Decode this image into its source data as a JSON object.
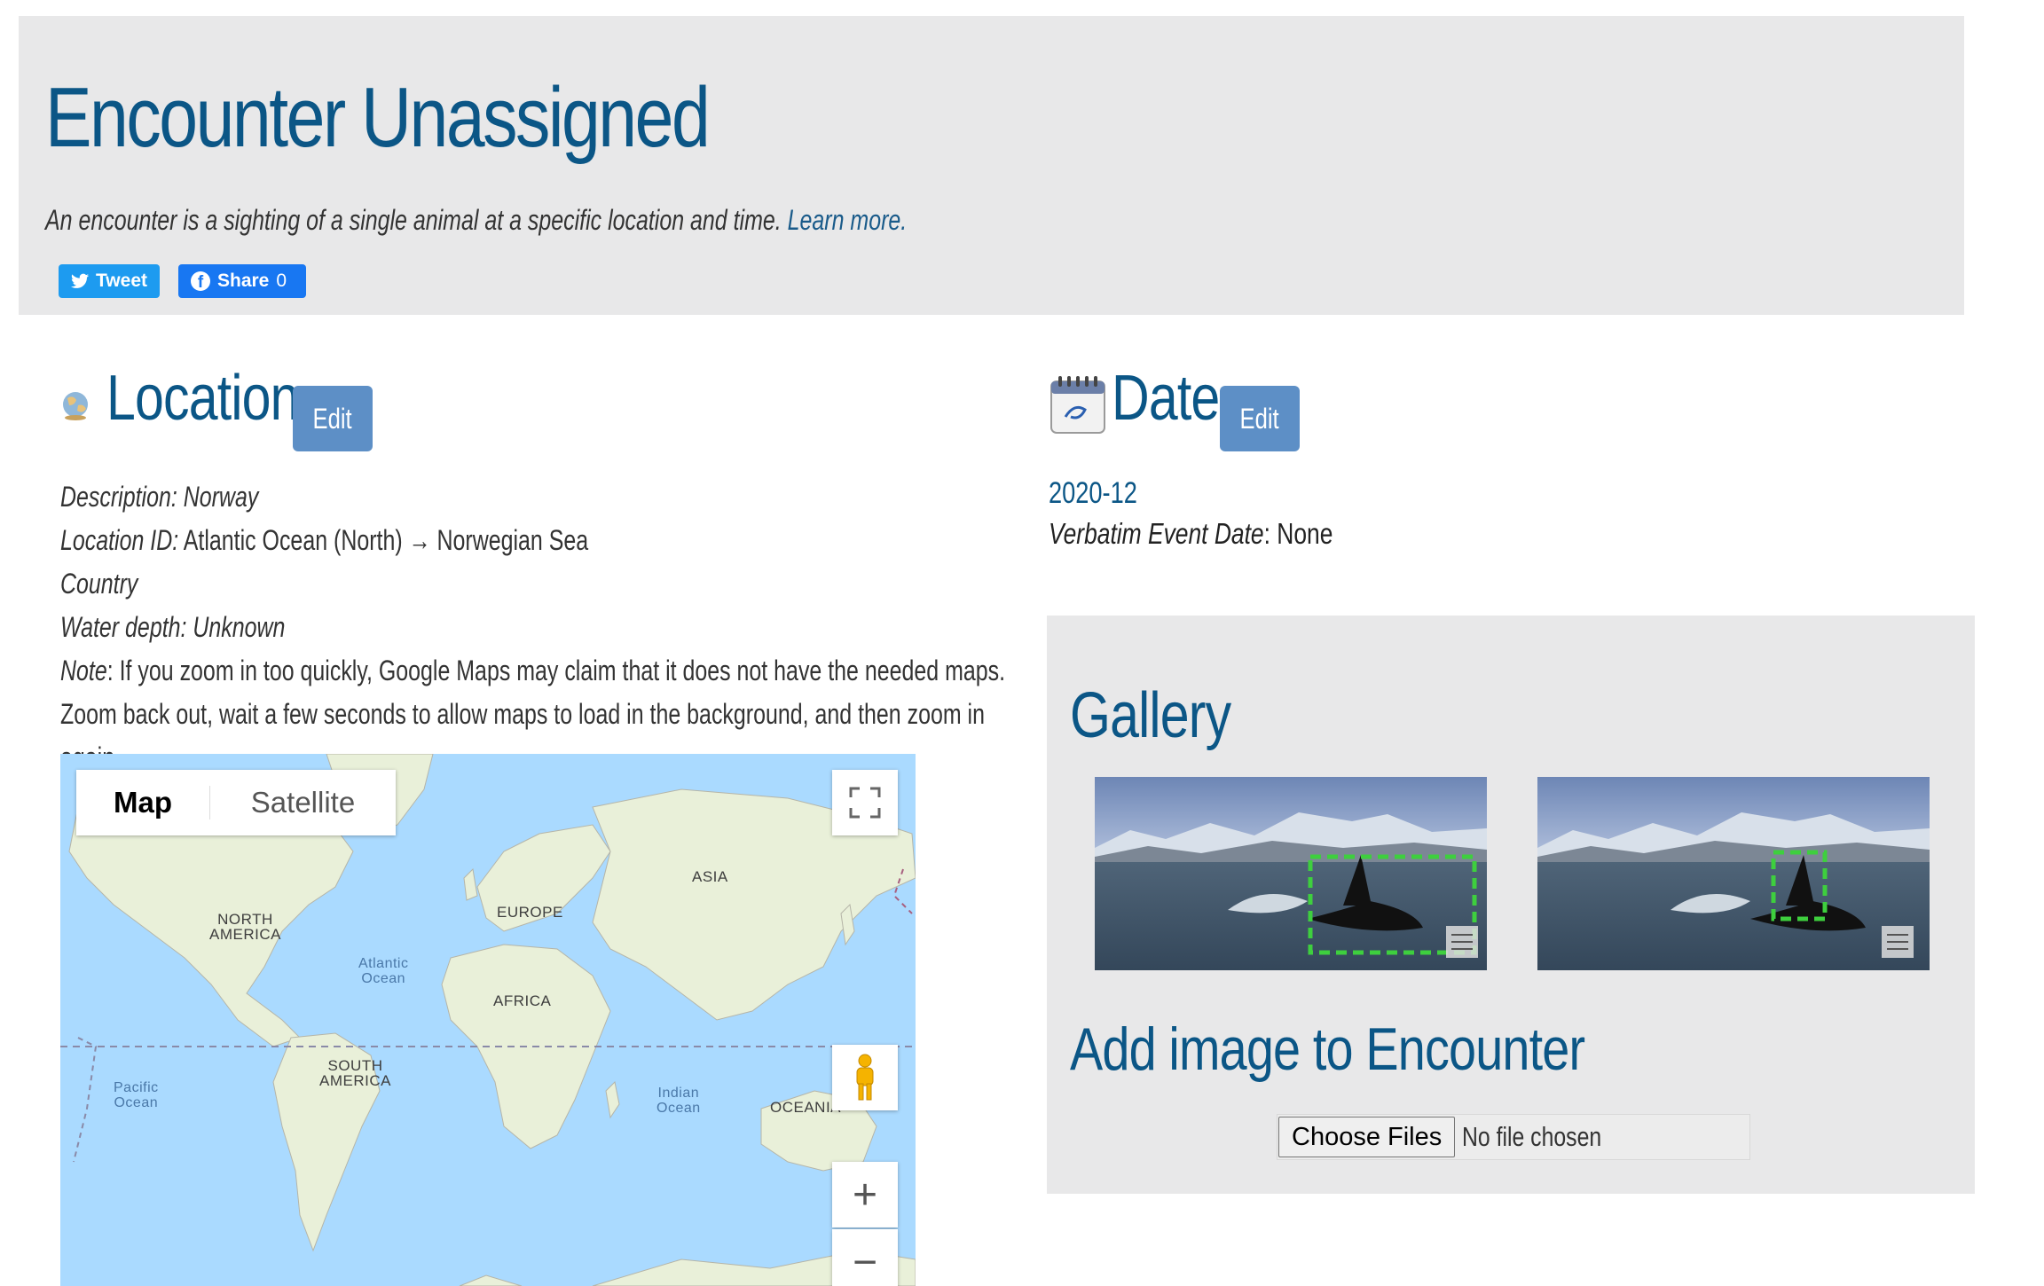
{
  "header": {
    "title": "Encounter Unassigned",
    "intro_text": "An encounter is a sighting of a single animal at a specific location and time.",
    "learn_more": "Learn more.",
    "tweet_label": "Tweet",
    "share_label": "Share",
    "share_count": "0"
  },
  "location": {
    "title": "Location",
    "edit_label": "Edit",
    "description_label": "Description:",
    "description_value": "Norway",
    "location_id_label": "Location ID:",
    "location_id_value": "Atlantic Ocean (North) → Norwegian Sea",
    "country_label": "Country",
    "water_depth_label": "Water depth:",
    "water_depth_value": "Unknown",
    "note_label": "Note",
    "note_text": ": If you zoom in too quickly, Google Maps may claim that it does not have the needed maps. Zoom back out, wait a few seconds to allow maps to load in the background, and then zoom in again."
  },
  "map": {
    "map_tab": "Map",
    "satellite_tab": "Satellite",
    "zoom_in": "+",
    "zoom_out": "−",
    "labels": {
      "north_america": "NORTH\nAMERICA",
      "europe": "EUROPE",
      "asia": "ASIA",
      "africa": "AFRICA",
      "south_america": "SOUTH\nAMERICA",
      "oceania": "OCEANIA",
      "atlantic": "Atlantic\nOcean",
      "pacific": "Pacific\nOcean",
      "indian": "Indian\nOcean"
    }
  },
  "date": {
    "title": "Date",
    "edit_label": "Edit",
    "value": "2020-12",
    "verbatim_label": "Verbatim Event Date",
    "verbatim_value": ": None"
  },
  "gallery": {
    "title": "Gallery",
    "add_title": "Add image to Encounter",
    "choose_files": "Choose Files",
    "no_file": "No file chosen"
  },
  "colors": {
    "title_blue": "#0b5686",
    "edit_button": "#5d8fc6",
    "panel_gray": "#e8e8e9",
    "ocean": "#aadaff",
    "land": "#e8f0d4"
  }
}
